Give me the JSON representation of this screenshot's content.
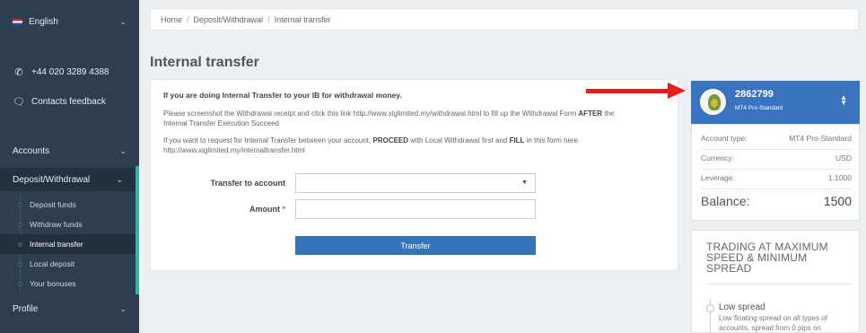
{
  "sidebar": {
    "language": "English",
    "phone": "+44 020 3289 4388",
    "contacts": "Contacts feedback",
    "accounts": "Accounts",
    "deposit_withdrawal": "Deposit/Withdrawal",
    "sub_items": [
      "Deposit funds",
      "Withdraw funds",
      "Internal transfer",
      "Local deposit",
      "Your bonuses"
    ],
    "profile": "Profile"
  },
  "breadcrumb": [
    "Home",
    "Deposit/Withdrawal",
    "Internal transfer"
  ],
  "page_title": "Internal transfer",
  "notice": {
    "heading": "If you are doing Internal Transfer to your IB for withdrawal money.",
    "line1": "Please screenshot the Withdrawal receipt and click this link http://www.xiglimited.my/withdrawal.html to fill up the Withdrawal Form",
    "line1_bold": "AFTER",
    "line1_end": "the",
    "line2": "Internal Transfer Execution Succeed",
    "line3_a": "If you want to request for Internal Transfer between your account,",
    "line3_bold1": "PROCEED",
    "line3_b": "with Local Withdrawal first and",
    "line3_bold2": "FILL",
    "line3_c": "in this form here",
    "line4": "http://www.xiglimited.my/internaltransfer.html"
  },
  "form": {
    "transfer_label": "Transfer to account",
    "amount_label": "Amount",
    "required_mark": "*",
    "transfer_value": "",
    "amount_value": "",
    "submit": "Transfer"
  },
  "account": {
    "number": "2862799",
    "type": "MT4 Pro-Standard",
    "rows": [
      {
        "label": "Account type:",
        "value": "MT4 Pro-Standard"
      },
      {
        "label": "Currency:",
        "value": "USD"
      },
      {
        "label": "Leverage:",
        "value": "1:1000"
      }
    ],
    "balance_label": "Balance:",
    "balance_value": "1500"
  },
  "promo": {
    "title": "TRADING AT MAXIMUM SPEED & MINIMUM SPREAD",
    "item_title": "Low spread",
    "item_text": "Low floating spread on all types of accounts, spread from 0 pips on"
  },
  "colors": {
    "sidebar_bg": "#2d3e50",
    "accent_teal": "#2eb8a0",
    "primary_blue": "#3375b8",
    "account_blue": "#3a74c1",
    "arrow_red": "#e41d1d"
  },
  "icons": [
    "flag-uk-icon",
    "phone-icon",
    "chat-icon",
    "chevron-down-icon",
    "caret-down-icon",
    "sort-toggle-icon"
  ]
}
